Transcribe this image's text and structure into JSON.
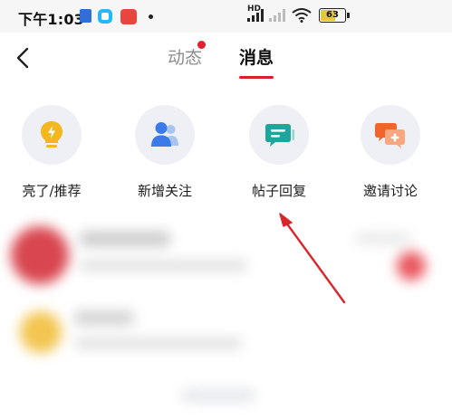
{
  "status_bar": {
    "time": "下午1:03",
    "network": "HD",
    "battery": "63",
    "battery_level": 0.63
  },
  "header": {
    "tabs": [
      {
        "label": "动态",
        "active": false,
        "has_badge": true
      },
      {
        "label": "消息",
        "active": true,
        "has_badge": false
      }
    ]
  },
  "categories": [
    {
      "label": "亮了/推荐",
      "icon": "lightbulb-icon",
      "color": "#f5b720"
    },
    {
      "label": "新增关注",
      "icon": "user-add-icon",
      "color": "#3b7be8"
    },
    {
      "label": "帖子回复",
      "icon": "chat-reply-icon",
      "color": "#1fa69c"
    },
    {
      "label": "邀请讨论",
      "icon": "invite-discuss-icon",
      "color": "#f2652a"
    }
  ],
  "colors": {
    "accent": "#d8202a",
    "badge": "#e0202c",
    "annotation_arrow": "#d8262c"
  }
}
